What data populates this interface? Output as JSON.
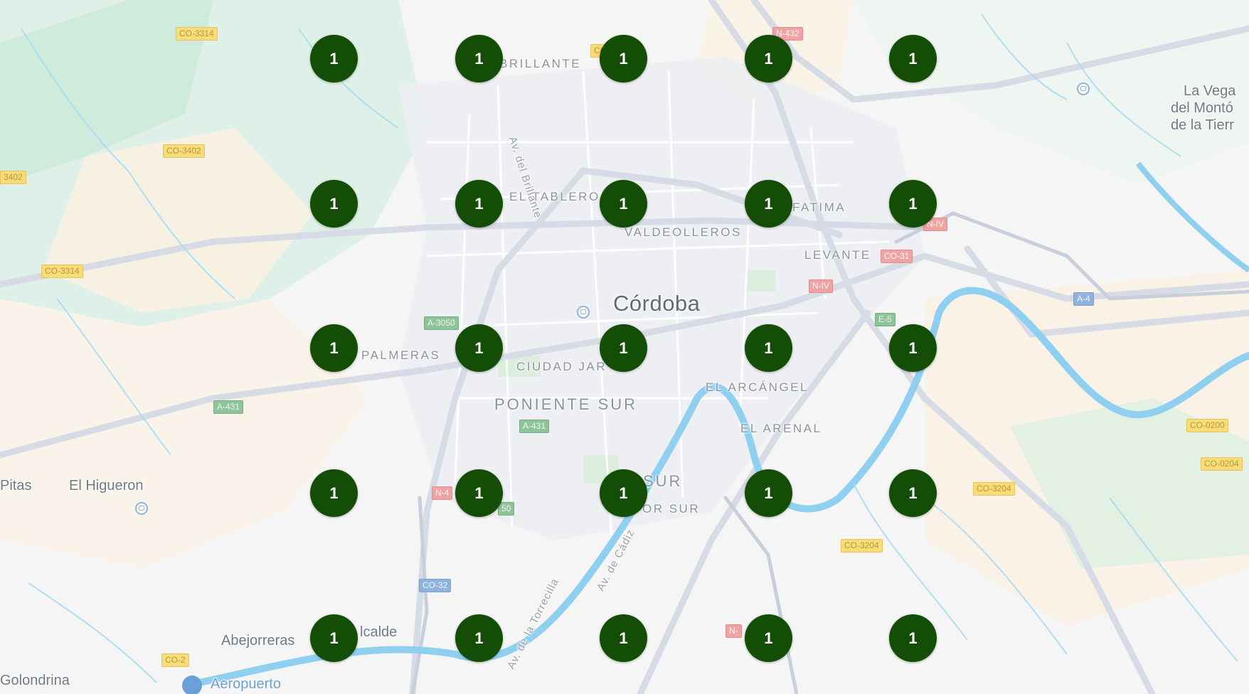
{
  "city_label": "Córdoba",
  "place_labels": [
    {
      "id": "la-vega",
      "text": "La Vega"
    },
    {
      "id": "del-monto",
      "text": "del Montó"
    },
    {
      "id": "de-la-tierra",
      "text": "de la Tierr"
    },
    {
      "id": "pitas",
      "text": "Pitas"
    },
    {
      "id": "el-higueron",
      "text": "El Higueron"
    },
    {
      "id": "abejorreras",
      "text": "Abejorreras"
    },
    {
      "id": "alcalde",
      "text": "lcalde"
    },
    {
      "id": "golondrina",
      "text": "Golondrina"
    }
  ],
  "airport_label": "Aeropuerto",
  "district_labels": [
    {
      "id": "brillante",
      "text": "BRILLANTE"
    },
    {
      "id": "el-tablero",
      "text": "EL TABLERO"
    },
    {
      "id": "fatima",
      "text": "FATIMA"
    },
    {
      "id": "valdeolleros",
      "text": "VALDEOLLEROS"
    },
    {
      "id": "levante",
      "text": "LEVANTE"
    },
    {
      "id": "palmeras",
      "text": "PALMERAS"
    },
    {
      "id": "ciudad-jardin",
      "text": "CIUDAD JAR"
    },
    {
      "id": "poniente-sur",
      "text": "PONIENTE SUR"
    },
    {
      "id": "el-arcangel",
      "text": "EL ARCÁNGEL"
    },
    {
      "id": "el-arenal",
      "text": "EL ARENAL"
    },
    {
      "id": "sur",
      "text": "SUR"
    },
    {
      "id": "sector-sur",
      "text": "OR SUR"
    }
  ],
  "street_labels": [
    {
      "id": "av-brillante",
      "text": "Av. del Brillante"
    },
    {
      "id": "av-torrecilla",
      "text": "Av. de la Torrecilla"
    },
    {
      "id": "av-cadiz",
      "text": "Av. de Cádiz"
    }
  ],
  "road_shields": [
    {
      "id": "co3314-top",
      "text": "CO-3314",
      "type": "co"
    },
    {
      "id": "co3402",
      "text": "CO-3402",
      "type": "co"
    },
    {
      "id": "co3402-left",
      "text": "3402",
      "type": "co"
    },
    {
      "id": "co3314-left",
      "text": "CO-3314",
      "type": "co"
    },
    {
      "id": "n432",
      "text": "N-432",
      "type": "n"
    },
    {
      "id": "a3050",
      "text": "A-3050",
      "type": "a"
    },
    {
      "id": "a431-left",
      "text": "A-431",
      "type": "a"
    },
    {
      "id": "a431-mid",
      "text": "A-431",
      "type": "a"
    },
    {
      "id": "niv-top",
      "text": "N-IV",
      "type": "n"
    },
    {
      "id": "co31",
      "text": "CO-31",
      "type": "n"
    },
    {
      "id": "niv-mid",
      "text": "N-IV",
      "type": "n"
    },
    {
      "id": "e5",
      "text": "E-5",
      "type": "a"
    },
    {
      "id": "a4",
      "text": "A-4",
      "type": "b"
    },
    {
      "id": "n-sw",
      "text": "N-4",
      "type": "n"
    },
    {
      "id": "a50",
      "text": "50",
      "type": "a"
    },
    {
      "id": "co32",
      "text": "CO-32",
      "type": "b"
    },
    {
      "id": "n-s",
      "text": "N-",
      "type": "n"
    },
    {
      "id": "co3204",
      "text": "CO-3204",
      "type": "co"
    },
    {
      "id": "co3204b",
      "text": "CO-3204",
      "type": "co"
    },
    {
      "id": "co0200",
      "text": "CO-0200",
      "type": "co"
    },
    {
      "id": "co0204",
      "text": "CO-0204",
      "type": "co"
    },
    {
      "id": "co12",
      "text": "CO-2",
      "type": "co"
    },
    {
      "id": "co-top2",
      "text": "CO",
      "type": "co"
    }
  ],
  "markers": [
    {
      "count": "1"
    },
    {
      "count": "1"
    },
    {
      "count": "1"
    },
    {
      "count": "1"
    },
    {
      "count": "1"
    },
    {
      "count": "1"
    },
    {
      "count": "1"
    },
    {
      "count": "1"
    },
    {
      "count": "1"
    },
    {
      "count": "1"
    },
    {
      "count": "1"
    },
    {
      "count": "1"
    },
    {
      "count": "1"
    },
    {
      "count": "1"
    },
    {
      "count": "1"
    },
    {
      "count": "1"
    },
    {
      "count": "1"
    },
    {
      "count": "1"
    },
    {
      "count": "1"
    },
    {
      "count": "1"
    },
    {
      "count": "1"
    },
    {
      "count": "1"
    },
    {
      "count": "1"
    },
    {
      "count": "1"
    },
    {
      "count": "1"
    }
  ],
  "colors": {
    "marker_fill": "#144d06",
    "marker_text": "#ffffff",
    "water": "#7ec8ef",
    "park": "#cfe9d6"
  }
}
